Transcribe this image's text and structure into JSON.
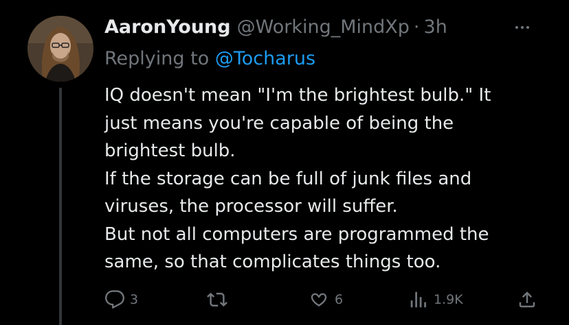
{
  "tweet": {
    "author": {
      "display_name": "AaronYoung",
      "handle": "@Working_MindXp",
      "separator": "·",
      "time": "3h",
      "avatar": "avatar-photo"
    },
    "replying_prefix": "Replying to ",
    "replying_to": "@Tocharus",
    "text_lines": [
      "IQ doesn't mean \"I'm the brightest bulb.\" It",
      "just means you're capable of being the",
      "brightest bulb.",
      "If the storage can be full of junk files and",
      "viruses, the processor will suffer.",
      "But not all computers are programmed the",
      "same, so that complicates things too."
    ],
    "actions": {
      "reply": {
        "icon": "reply-icon",
        "count": "3"
      },
      "retweet": {
        "icon": "retweet-icon",
        "count": ""
      },
      "like": {
        "icon": "heart-icon",
        "count": "6"
      },
      "views": {
        "icon": "views-icon",
        "count": "1.9K"
      },
      "share": {
        "icon": "share-icon"
      }
    },
    "more_icon": "more-options-icon"
  },
  "colors": {
    "background": "#000000",
    "text_primary": "#e7e9ea",
    "text_secondary": "#71767b",
    "accent": "#1d9bf0",
    "thread_line": "#333639"
  }
}
